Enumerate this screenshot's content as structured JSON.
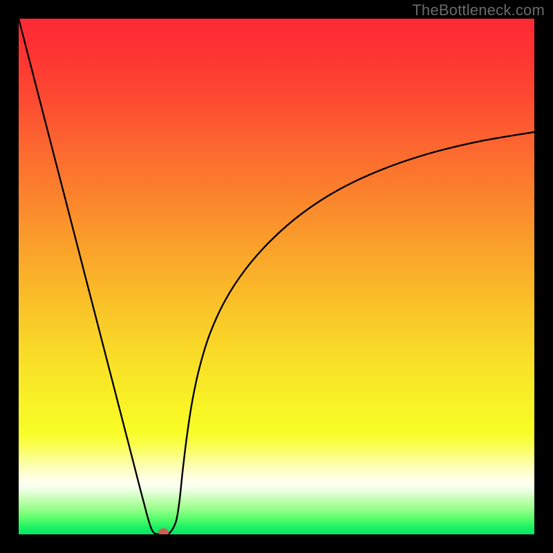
{
  "watermark": {
    "text": "TheBottleneck.com"
  },
  "chart_data": {
    "type": "line",
    "title": "",
    "xlabel": "",
    "ylabel": "",
    "xlim": [
      0,
      1
    ],
    "ylim": [
      0,
      1.06
    ],
    "grid": false,
    "legend": false,
    "background_gradient": {
      "stops": [
        {
          "offset": 0.0,
          "color": "#fe2a34"
        },
        {
          "offset": 0.07,
          "color": "#fe3433"
        },
        {
          "offset": 0.16,
          "color": "#fd4c31"
        },
        {
          "offset": 0.26,
          "color": "#fc6a2f"
        },
        {
          "offset": 0.36,
          "color": "#fb882c"
        },
        {
          "offset": 0.46,
          "color": "#faa62a"
        },
        {
          "offset": 0.56,
          "color": "#f9c328"
        },
        {
          "offset": 0.66,
          "color": "#f9de27"
        },
        {
          "offset": 0.74,
          "color": "#f8f126"
        },
        {
          "offset": 0.8,
          "color": "#f8fc26"
        },
        {
          "offset": 0.825,
          "color": "#f9ff4a"
        },
        {
          "offset": 0.85,
          "color": "#fbff88"
        },
        {
          "offset": 0.875,
          "color": "#fdffc4"
        },
        {
          "offset": 0.9,
          "color": "#fffff2"
        },
        {
          "offset": 0.915,
          "color": "#ecffe1"
        },
        {
          "offset": 0.93,
          "color": "#c9ffb9"
        },
        {
          "offset": 0.95,
          "color": "#9aff8d"
        },
        {
          "offset": 0.97,
          "color": "#58fd6c"
        },
        {
          "offset": 0.985,
          "color": "#1ff364"
        },
        {
          "offset": 1.0,
          "color": "#04e864"
        }
      ]
    },
    "series": [
      {
        "name": "bottleneck-curve",
        "color": "#000000",
        "x": [
          0.0,
          0.02,
          0.04,
          0.06,
          0.08,
          0.1,
          0.12,
          0.14,
          0.16,
          0.18,
          0.2,
          0.22,
          0.24,
          0.258,
          0.274,
          0.288,
          0.298,
          0.306,
          0.312,
          0.318,
          0.326,
          0.336,
          0.35,
          0.37,
          0.4,
          0.44,
          0.49,
          0.55,
          0.62,
          0.7,
          0.79,
          0.89,
          1.0
        ],
        "y": [
          1.06,
          0.978,
          0.896,
          0.814,
          0.732,
          0.65,
          0.568,
          0.486,
          0.404,
          0.322,
          0.24,
          0.158,
          0.076,
          0.01,
          0.0,
          0.0,
          0.01,
          0.03,
          0.07,
          0.13,
          0.2,
          0.27,
          0.34,
          0.41,
          0.48,
          0.545,
          0.605,
          0.66,
          0.708,
          0.748,
          0.781,
          0.807,
          0.827
        ]
      }
    ],
    "marker": {
      "x": 0.281,
      "y": 0.004,
      "rx": 0.01,
      "ry": 0.008,
      "fill": "#cf5f52"
    }
  }
}
